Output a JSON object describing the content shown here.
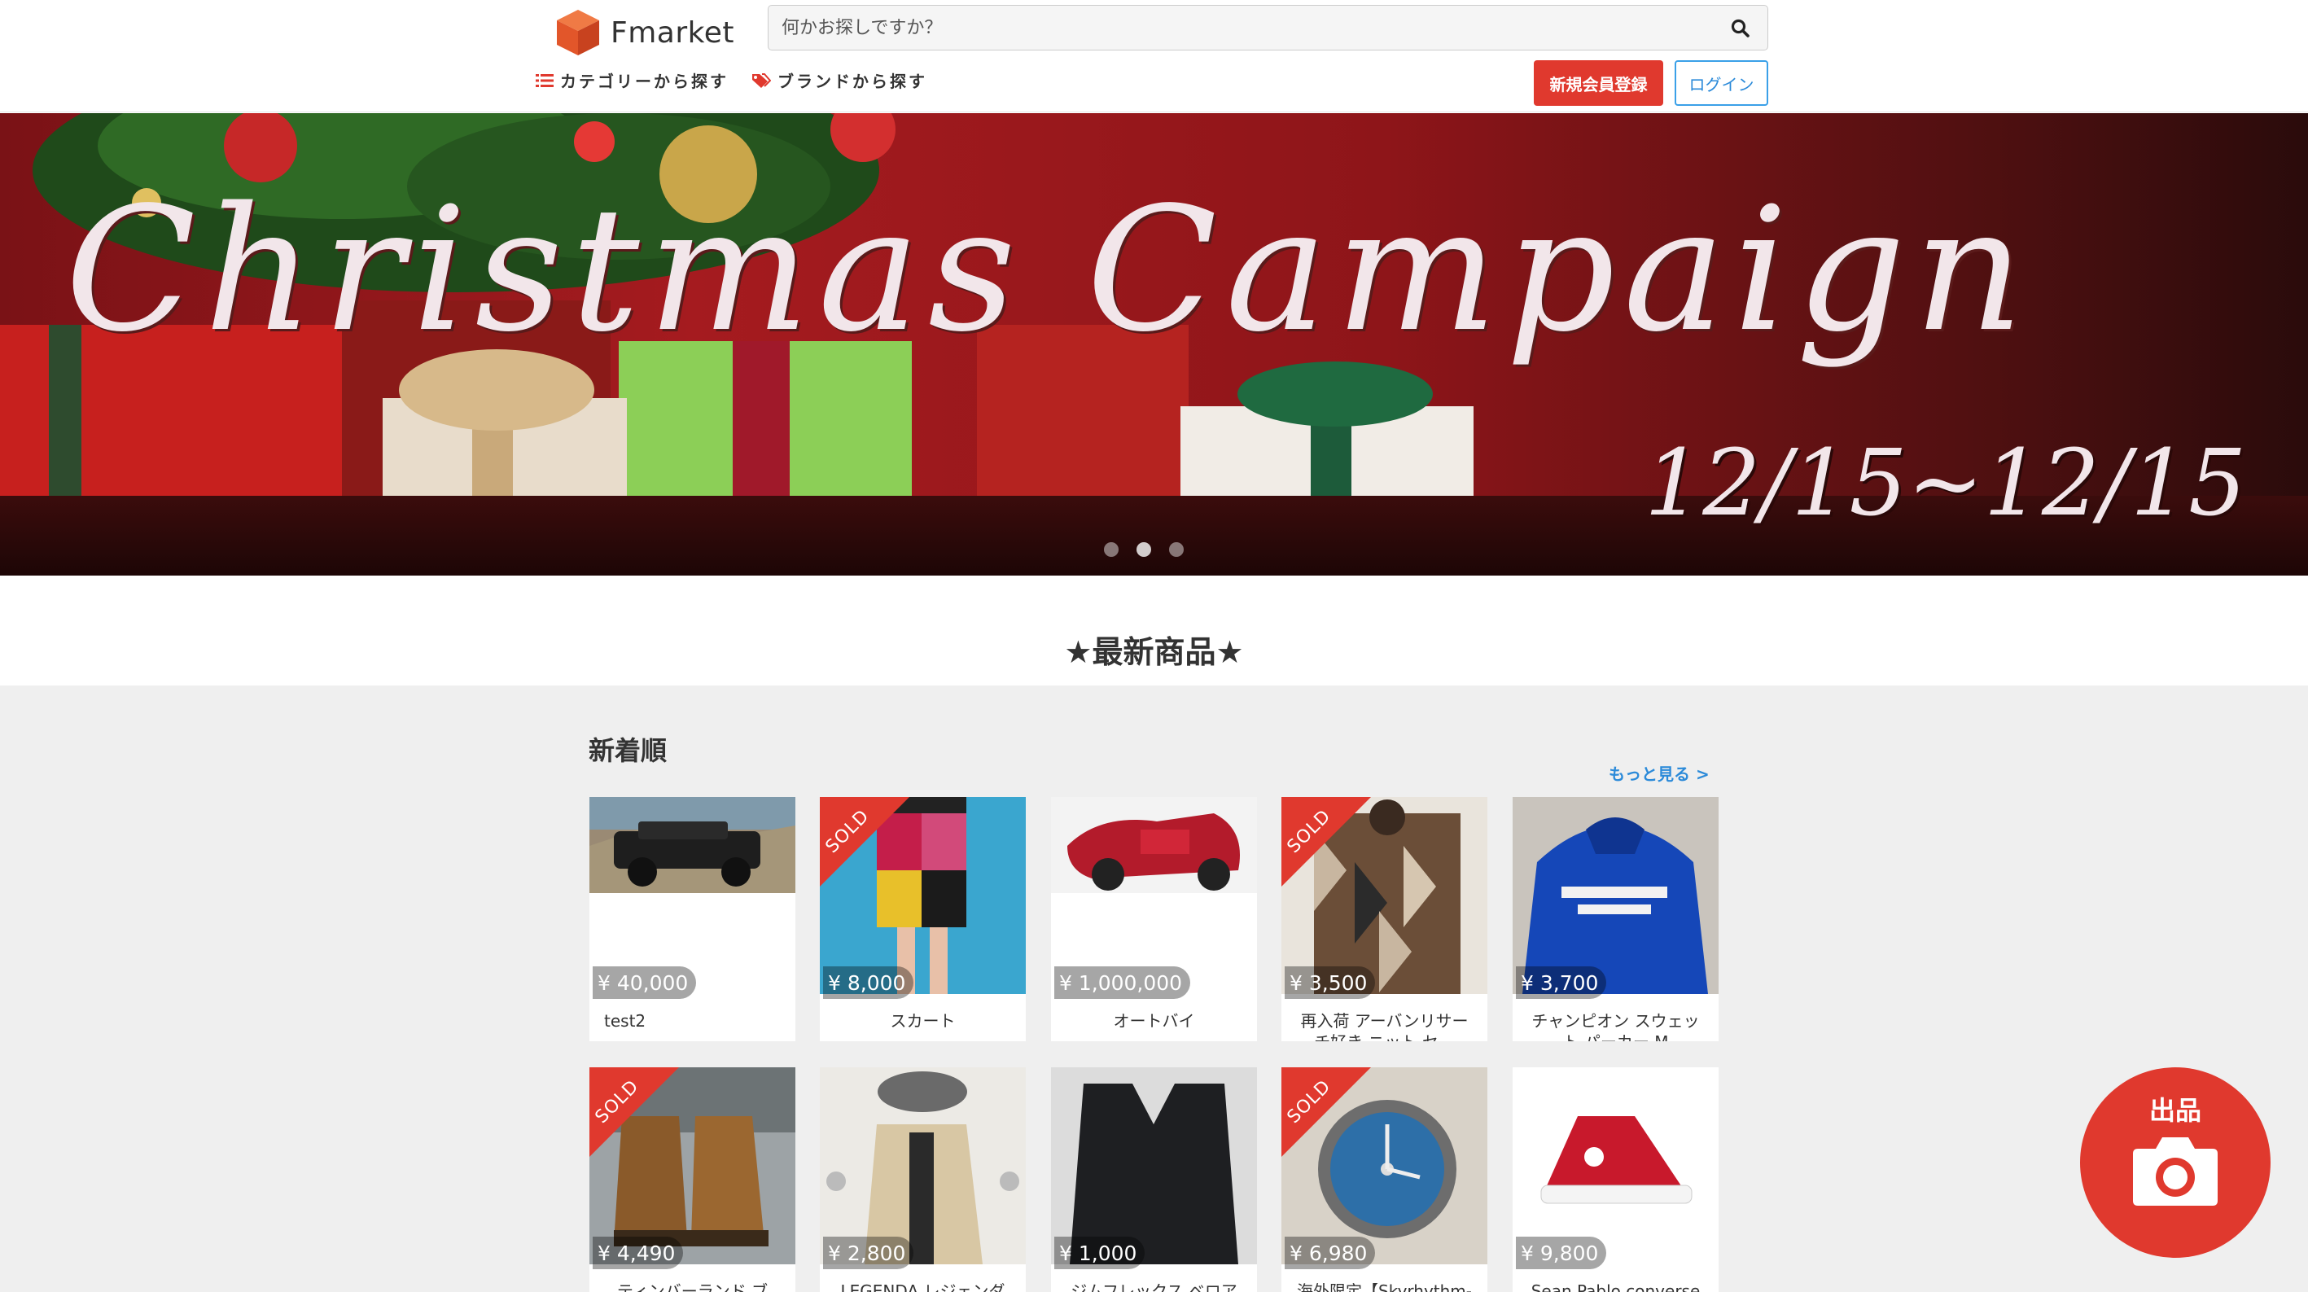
{
  "header": {
    "logo_text": "Fmarket",
    "search_placeholder": "何かお探しですか？",
    "nav": [
      {
        "label": "カテゴリーから探す",
        "icon": "list-icon"
      },
      {
        "label": "ブランドから探す",
        "icon": "tag-icon"
      }
    ],
    "register_label": "新規会員登録",
    "login_label": "ログイン"
  },
  "banner": {
    "title": "Christmas Campaign",
    "date": "12/15~12/15",
    "slide_count": 3,
    "active_slide": 1
  },
  "main": {
    "section_title": "★最新商品★",
    "subsection_title": "新着順",
    "more_label": "もっと見る >"
  },
  "items": [
    {
      "price": "¥ 40,000",
      "name": "test2",
      "sold": false
    },
    {
      "price": "¥ 8,000",
      "name": "スカート",
      "sold": true,
      "sold_label": "SOLD"
    },
    {
      "price": "¥ 1,000,000",
      "name": "オートバイ",
      "sold": false
    },
    {
      "price": "¥ 3,500",
      "name": "再入荷 アーバンリサーチ好き ニット セ…",
      "sold": true,
      "sold_label": "SOLD"
    },
    {
      "price": "¥ 3,700",
      "name": "チャンピオン スウェット パーカー M",
      "sold": false
    },
    {
      "price": "¥ 4,490",
      "name": "ティンバーランド ブ",
      "sold": true,
      "sold_label": "SOLD"
    },
    {
      "price": "¥ 2,800",
      "name": "LEGENDA レジェンダ",
      "sold": false
    },
    {
      "price": "¥ 1,000",
      "name": "ジムフレックス ベロア",
      "sold": false
    },
    {
      "price": "¥ 6,980",
      "name": "海外限定【Skyrhythm-",
      "sold": true,
      "sold_label": "SOLD"
    },
    {
      "price": "¥ 9,800",
      "name": "Sean Pablo converse",
      "sold": false
    }
  ],
  "sell_button": {
    "label": "出品",
    "icon": "camera-icon"
  },
  "colors": {
    "accent": "#e0392e",
    "link": "#2b8ad9",
    "gray_bg": "#efefef"
  }
}
